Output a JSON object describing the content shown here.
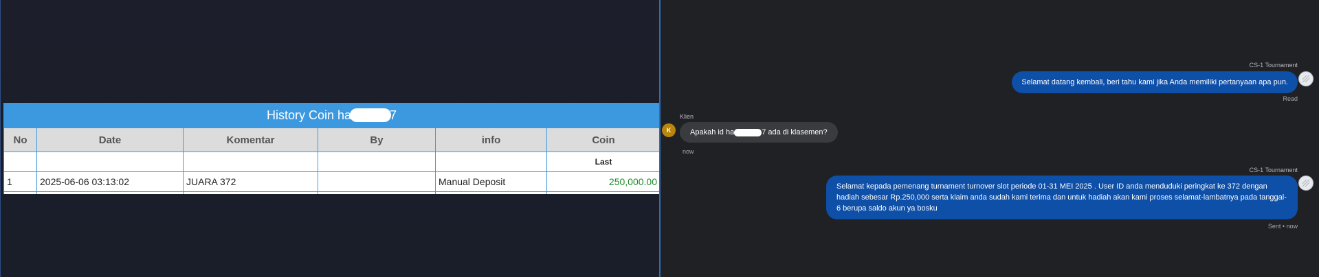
{
  "history": {
    "title_prefix": "History Coin ha",
    "title_suffix": "7",
    "columns": [
      "No",
      "Date",
      "Komentar",
      "By",
      "info",
      "Coin"
    ],
    "last_label": "Last",
    "rows": [
      {
        "no": "1",
        "date": "2025-06-06 03:13:02",
        "komentar": "JUARA 372",
        "by": "",
        "info": "Manual Deposit",
        "coin": "250,000.00"
      }
    ]
  },
  "chat": {
    "msg1": {
      "sender": "CS-1 Tournament",
      "text": "Selamat datang kembali, beri tahu kami jika Anda memiliki pertanyaan apa pun.",
      "status": "Read"
    },
    "msg2": {
      "sender": "Klien",
      "avatar_letter": "K",
      "text_prefix": "Apakah id ha",
      "text_suffix": "7 ada di klasemen?",
      "status": "now"
    },
    "msg3": {
      "sender": "CS-1 Tournament",
      "text": "Selamat kepada pemenang turnament turnover slot periode 01-31 MEI 2025 . User ID anda menduduki peringkat ke 372 dengan hadiah sebesar Rp.250,000 serta klaim anda sudah kami terima dan untuk hadiah akan kami proses selamat-lambatnya pada tanggal- 6 berupa saldo akun ya bosku",
      "status": "Sent • now"
    }
  },
  "colors": {
    "table_header": "#3c99e0",
    "agent_bubble": "#0e4fa8",
    "client_bubble": "#3a3b3f",
    "coin_green": "#1a8a28"
  }
}
